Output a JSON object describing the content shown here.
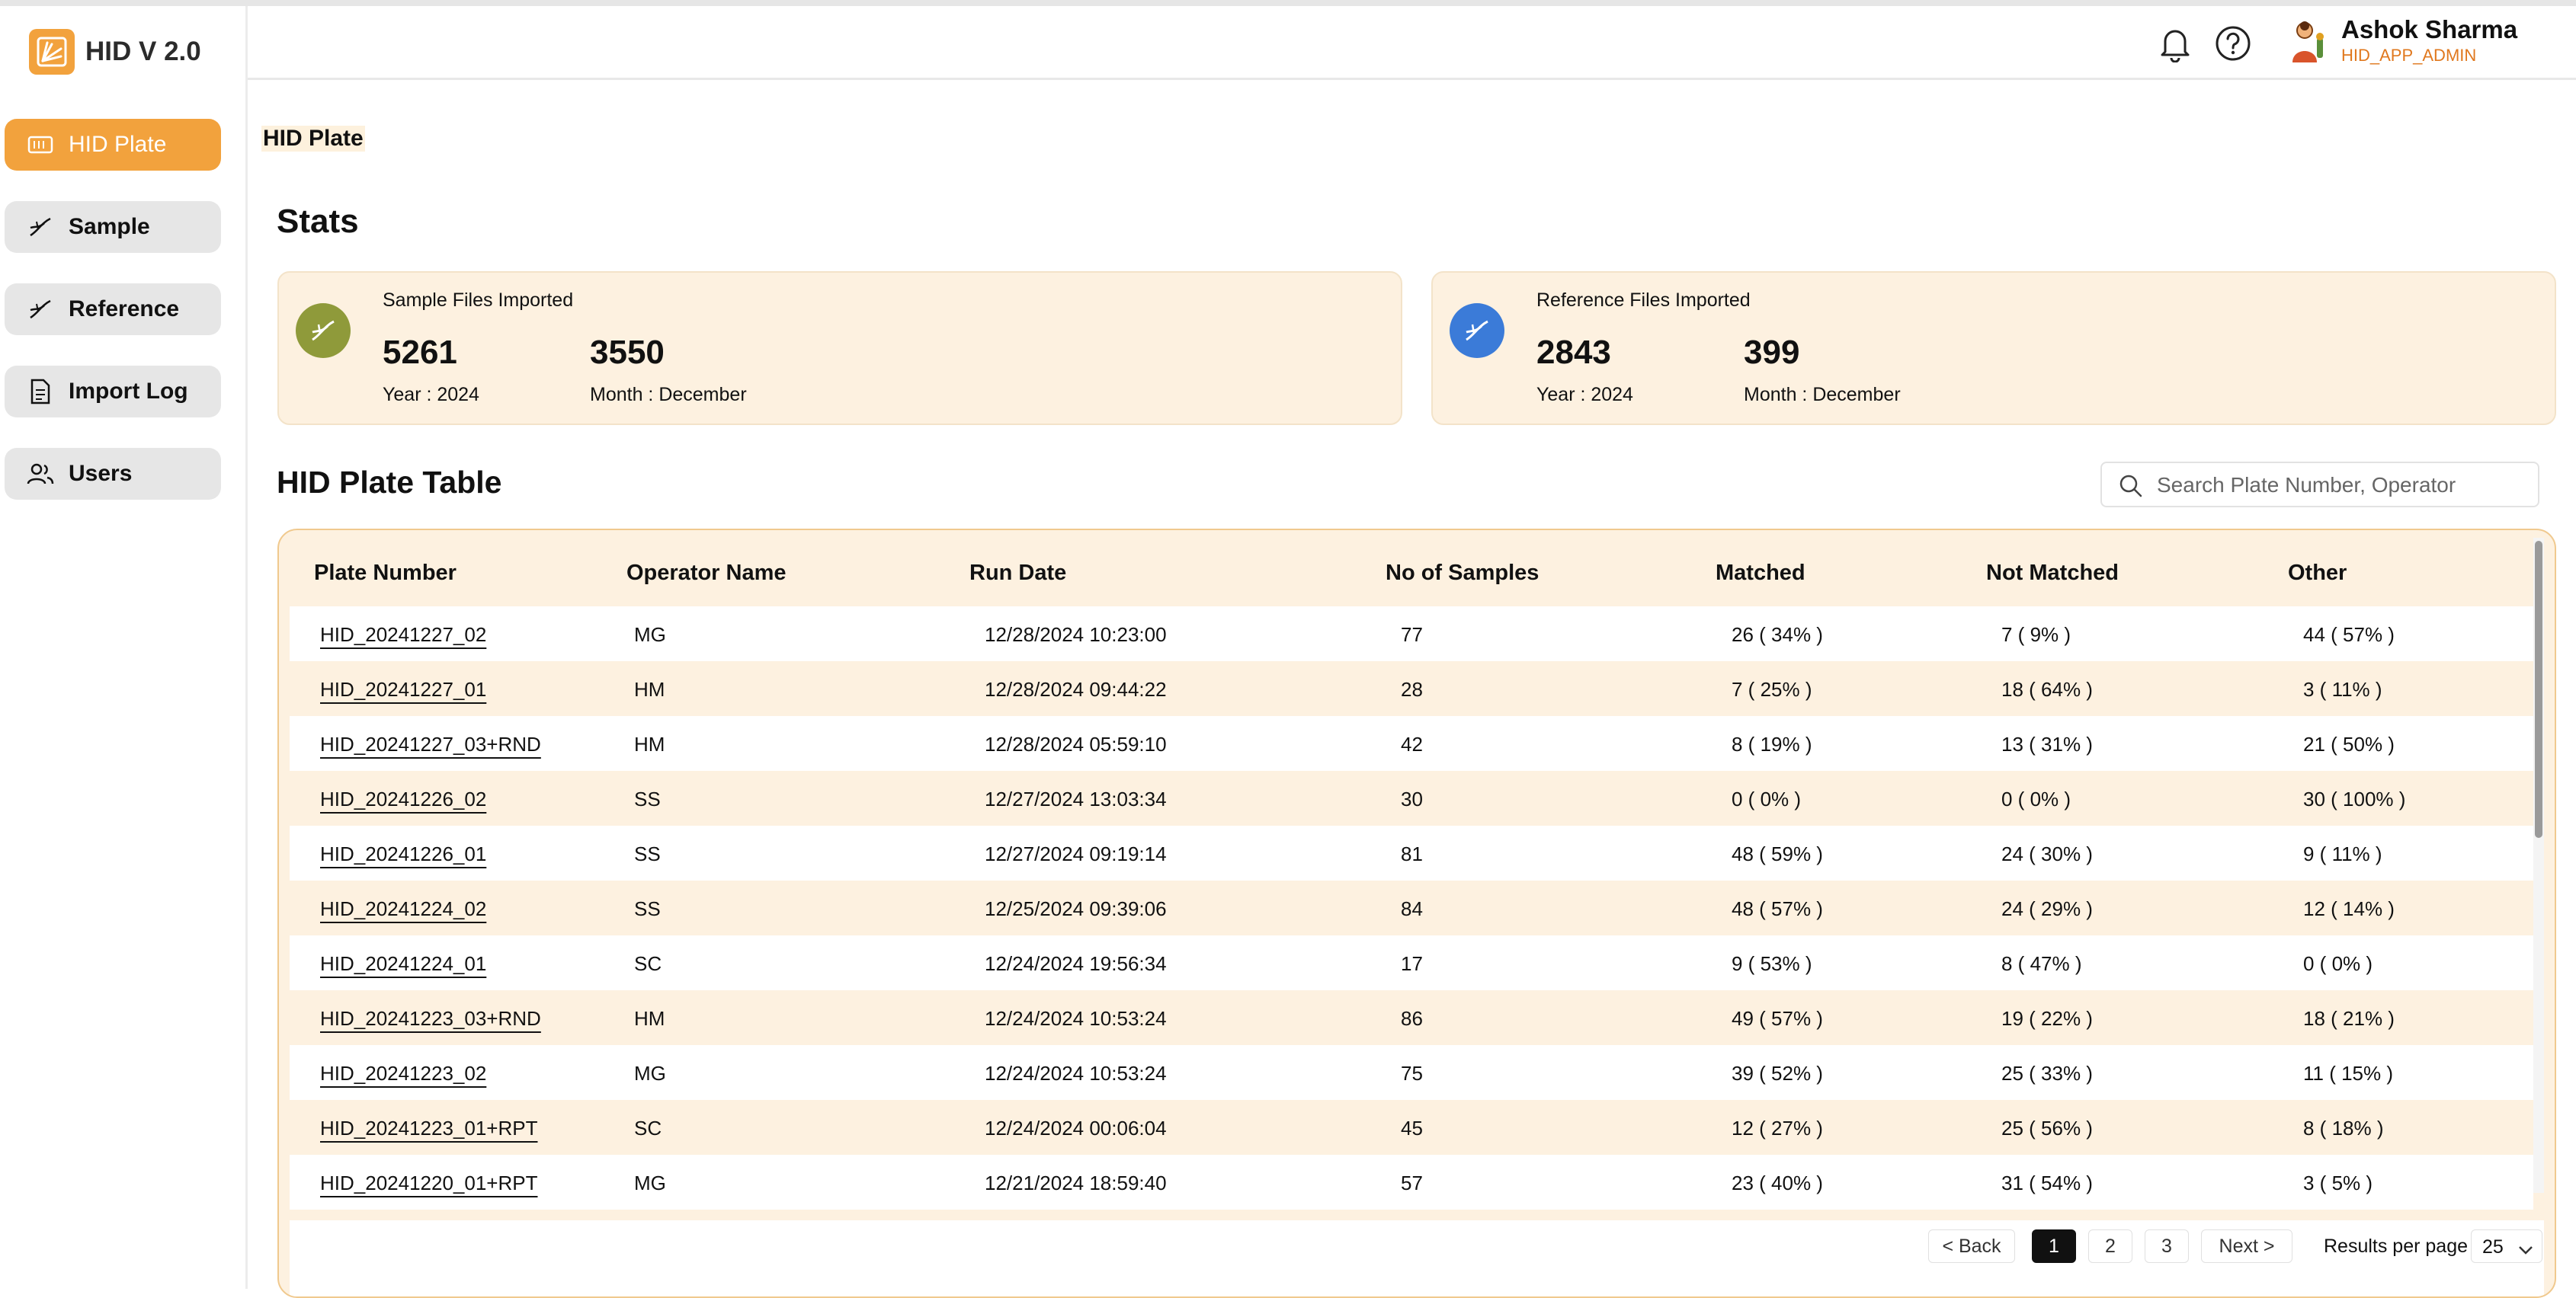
{
  "app": {
    "name": "HID V 2.0"
  },
  "sidebar": {
    "items": [
      {
        "label": "HID Plate",
        "icon": "plate-icon",
        "active": true
      },
      {
        "label": "Sample",
        "icon": "dna-icon"
      },
      {
        "label": "Reference",
        "icon": "dna-icon"
      },
      {
        "label": "Import Log",
        "icon": "document-icon"
      },
      {
        "label": "Users",
        "icon": "users-icon"
      }
    ]
  },
  "header": {
    "user_name": "Ashok Sharma",
    "user_role": "HID_APP_ADMIN",
    "icons": [
      "bell-icon",
      "help-icon",
      "avatar"
    ]
  },
  "breadcrumb": "HID Plate",
  "stats": {
    "title": "Stats",
    "cards": [
      {
        "title": "Sample Files Imported",
        "year_value": "5261",
        "year_label": "Year : 2024",
        "month_value": "3550",
        "month_label": "Month : December",
        "icon_color": "#8f9a3a"
      },
      {
        "title": "Reference Files Imported",
        "year_value": "2843",
        "year_label": "Year : 2024",
        "month_value": "399",
        "month_label": "Month : December",
        "icon_color": "#3b7bd8"
      }
    ]
  },
  "table": {
    "title": "HID Plate Table",
    "search_placeholder": "Search Plate Number, Operator",
    "columns": [
      "Plate Number",
      "Operator Name",
      "Run Date",
      "No of Samples",
      "Matched",
      "Not Matched",
      "Other"
    ],
    "rows": [
      [
        "HID_20241227_02",
        "MG",
        "12/28/2024 10:23:00",
        "77",
        "26 ( 34% )",
        "7 ( 9% )",
        "44 ( 57% )"
      ],
      [
        "HID_20241227_01",
        "HM",
        "12/28/2024 09:44:22",
        "28",
        "7 ( 25% )",
        "18 ( 64% )",
        "3 ( 11% )"
      ],
      [
        "HID_20241227_03+RND",
        "HM",
        "12/28/2024 05:59:10",
        "42",
        "8 ( 19% )",
        "13 ( 31% )",
        "21 ( 50% )"
      ],
      [
        "HID_20241226_02",
        "SS",
        "12/27/2024 13:03:34",
        "30",
        "0 ( 0% )",
        "0 ( 0% )",
        "30 ( 100% )"
      ],
      [
        "HID_20241226_01",
        "SS",
        "12/27/2024 09:19:14",
        "81",
        "48 ( 59% )",
        "24 ( 30% )",
        "9 ( 11% )"
      ],
      [
        "HID_20241224_02",
        "SS",
        "12/25/2024 09:39:06",
        "84",
        "48 ( 57% )",
        "24 ( 29% )",
        "12 ( 14% )"
      ],
      [
        "HID_20241224_01",
        "SC",
        "12/24/2024 19:56:34",
        "17",
        "9 ( 53% )",
        "8 ( 47% )",
        "0 ( 0% )"
      ],
      [
        "HID_20241223_03+RND",
        "HM",
        "12/24/2024 10:53:24",
        "86",
        "49 ( 57% )",
        "19 ( 22% )",
        "18 ( 21% )"
      ],
      [
        "HID_20241223_02",
        "MG",
        "12/24/2024 10:53:24",
        "75",
        "39 ( 52% )",
        "25 ( 33% )",
        "11 ( 15% )"
      ],
      [
        "HID_20241223_01+RPT",
        "SC",
        "12/24/2024 00:06:04",
        "45",
        "12 ( 27% )",
        "25 ( 56% )",
        "8 ( 18% )"
      ],
      [
        "HID_20241220_01+RPT",
        "MG",
        "12/21/2024 18:59:40",
        "57",
        "23 ( 40% )",
        "31 ( 54% )",
        "3 ( 5% )"
      ]
    ]
  },
  "pagination": {
    "back": "< Back",
    "pages": [
      "1",
      "2",
      "3"
    ],
    "current": "1",
    "next": "Next >",
    "results_label": "Results per page",
    "results_value": "25"
  },
  "colors": {
    "accent": "#f2a23d",
    "card_bg": "#fdf1e0",
    "role": "#e0781e"
  }
}
